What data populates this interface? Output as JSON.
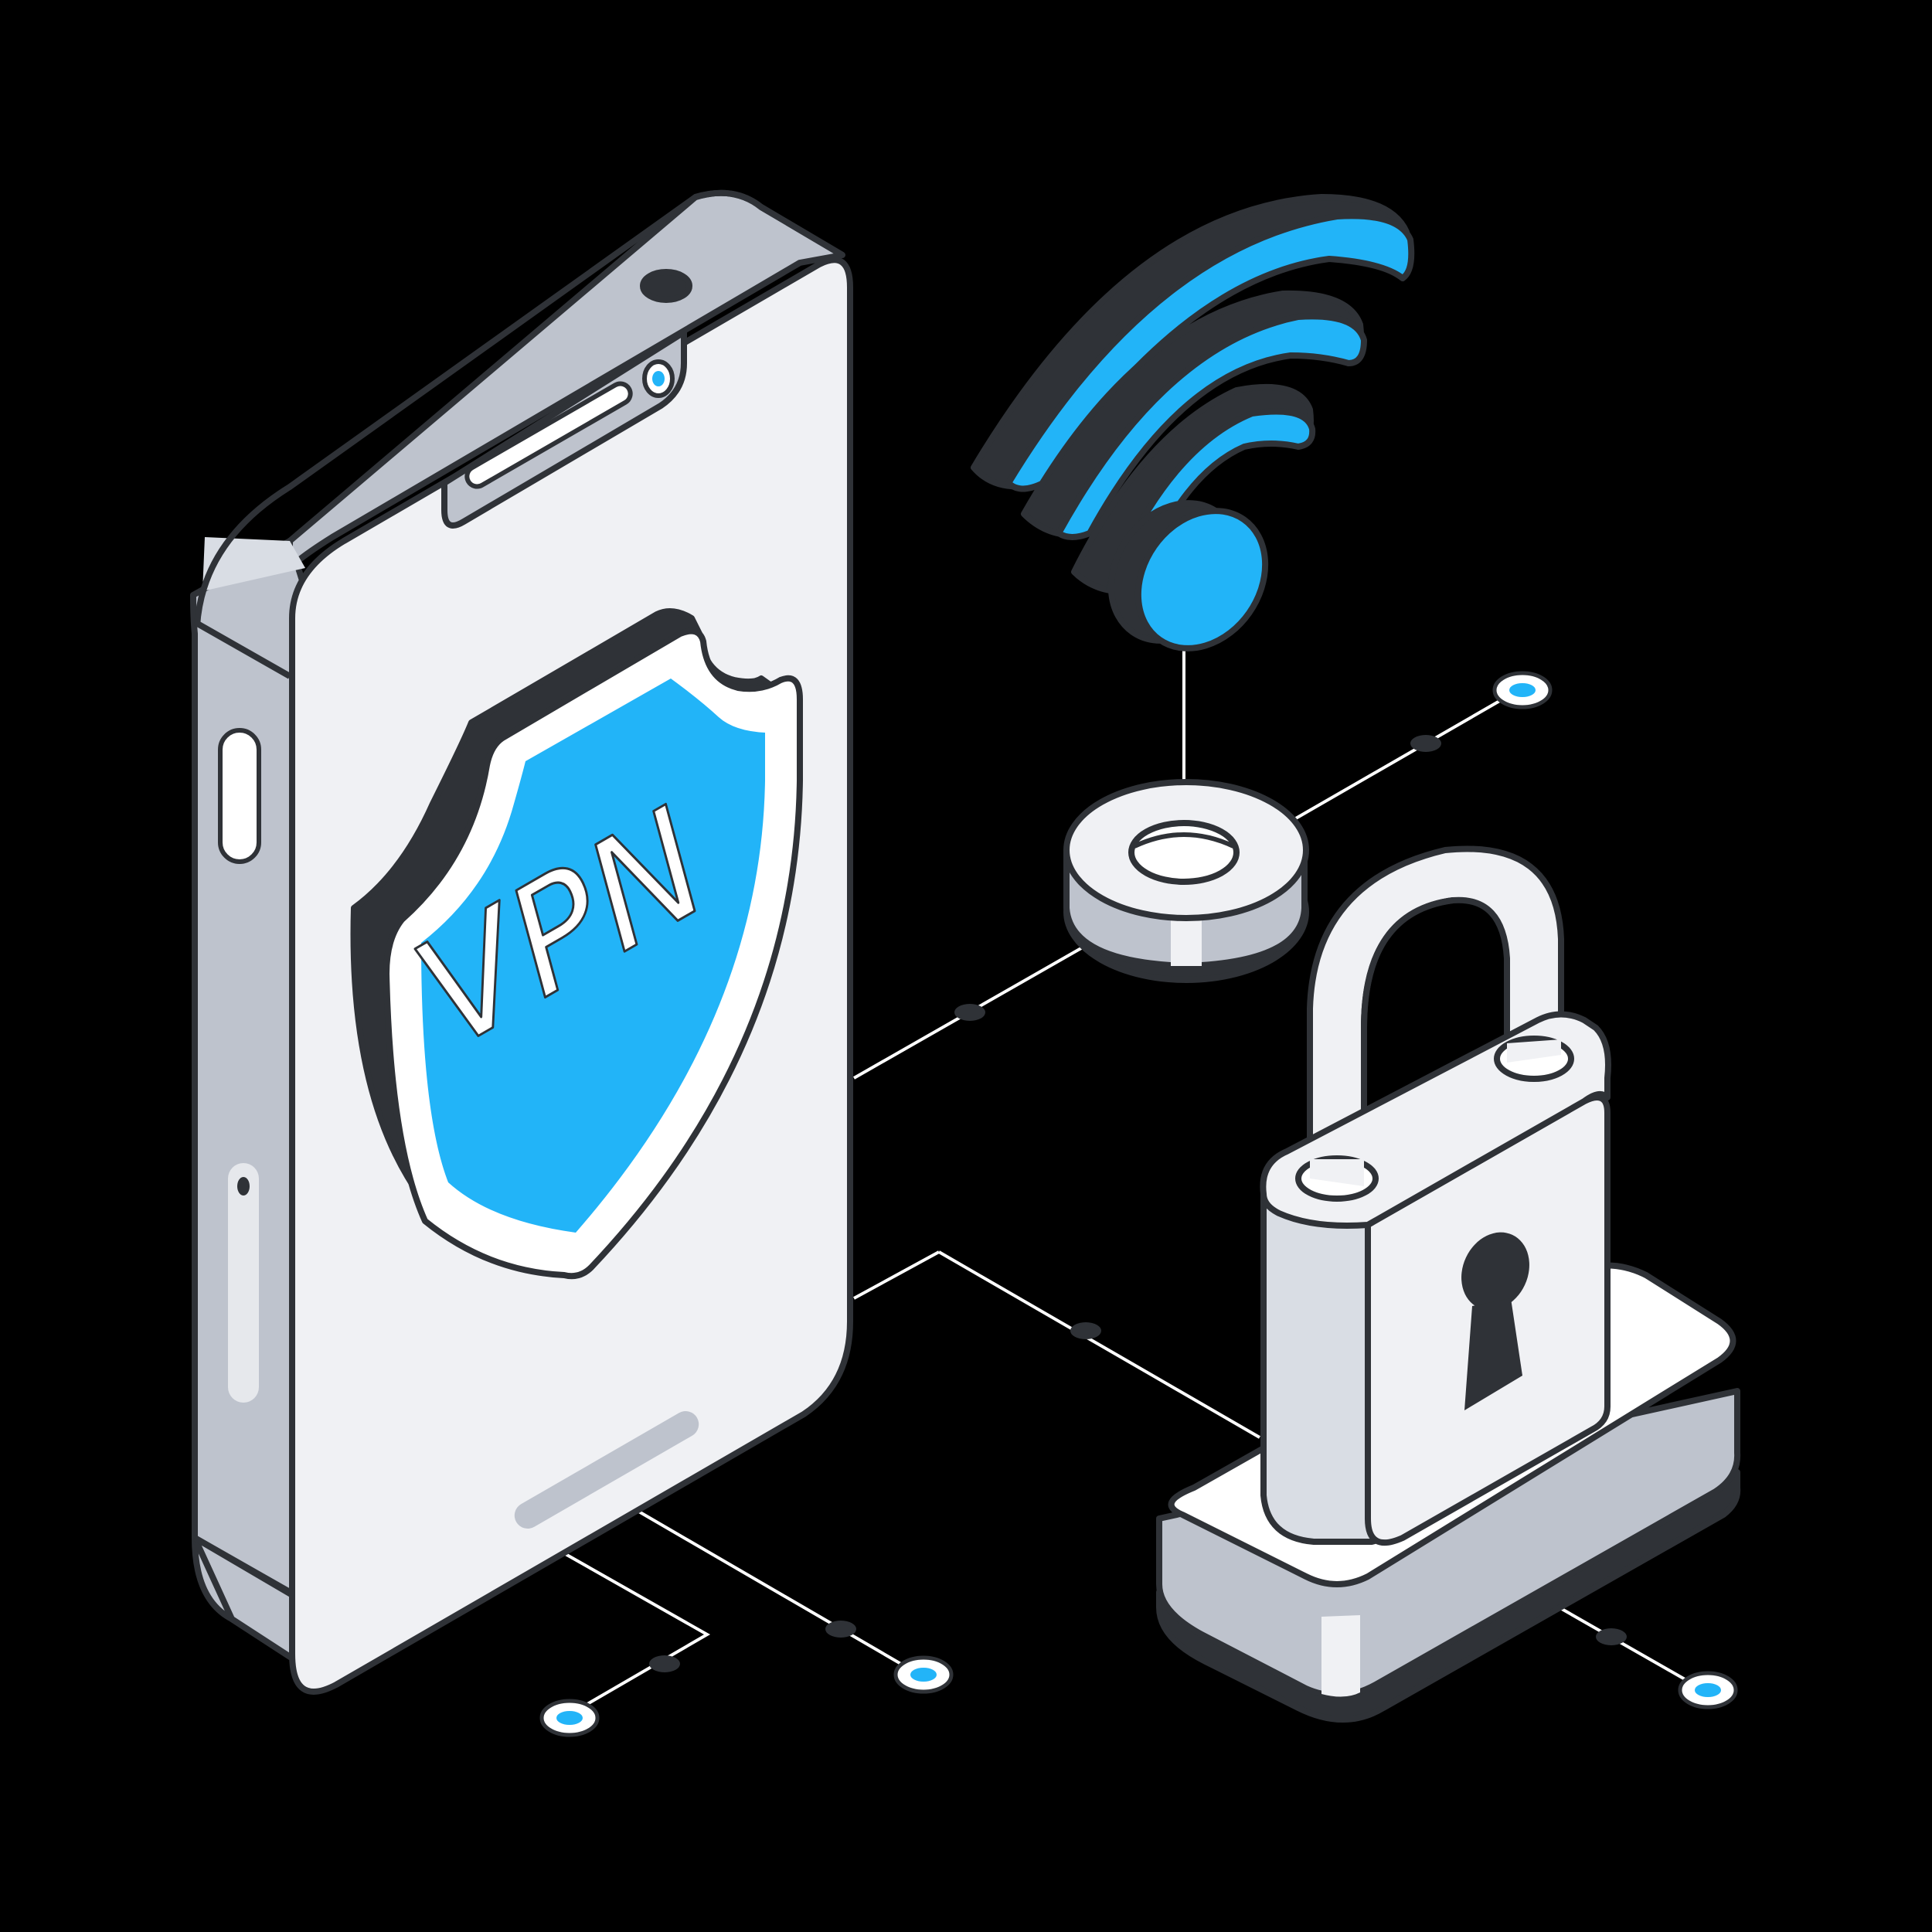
{
  "illustration": {
    "shield_label": "VPN",
    "icons": [
      "smartphone-icon",
      "shield-icon",
      "wifi-icon",
      "padlock-icon",
      "keyhole-icon",
      "connector-node-icon"
    ]
  },
  "colors": {
    "background": "#000000",
    "accent": "#22B4F8",
    "outline": "#2F3237",
    "device_light": "#F0F1F4",
    "device_mid": "#D9DDE4",
    "device_shade": "#BEC3CD",
    "white": "#FFFFFF"
  }
}
